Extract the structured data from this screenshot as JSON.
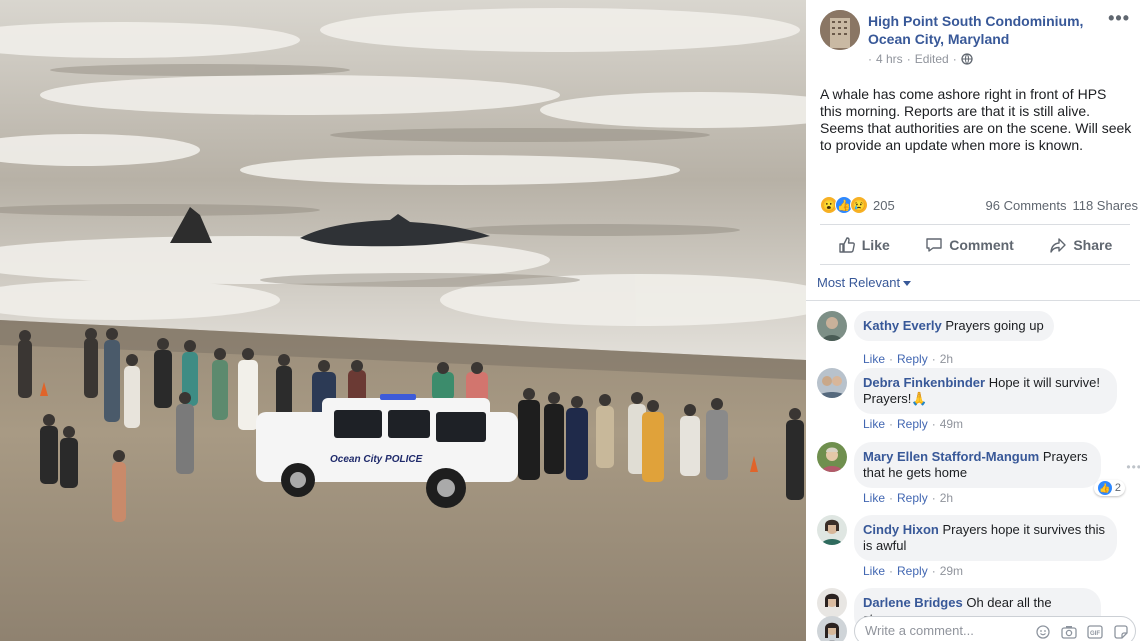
{
  "post": {
    "page_name_line1": "High Point South Condominium,",
    "page_name_line2": "Ocean City, Maryland",
    "time": "4 hrs",
    "edited": "Edited",
    "separator": "·",
    "text": "A whale has come ashore right in front of HPS this morning. Reports are that it is still alive. Seems that authorities are on the scene. Will seek to provide an update when more is known.",
    "reaction_count": "205",
    "comments_count": "96 Comments",
    "shares_count": "118 Shares"
  },
  "photo": {
    "vehicle_label": "Ocean City POLICE"
  },
  "actions": {
    "like": "Like",
    "comment": "Comment",
    "share": "Share"
  },
  "sort": {
    "label": "Most Relevant"
  },
  "comments": [
    {
      "name": "Kathy Everly",
      "text": "Prayers going up",
      "like": "Like",
      "reply": "Reply",
      "time": "2h"
    },
    {
      "name": "Debra Finkenbinder",
      "text": "Hope it will survive! Prayers!",
      "emoji": "🙏",
      "like": "Like",
      "reply": "Reply",
      "time": "49m"
    },
    {
      "name": "Mary Ellen Stafford-Mangum",
      "text": "Prayers that he gets home",
      "like": "Like",
      "reply": "Reply",
      "time": "2h",
      "reactions": "2"
    },
    {
      "name": "Cindy Hixon",
      "text": "Prayers hope it survives this is awful",
      "like": "Like",
      "reply": "Reply",
      "time": "29m"
    },
    {
      "name": "Darlene Bridges",
      "text": "Oh dear all the storms"
    }
  ],
  "composer": {
    "placeholder": "Write a comment..."
  },
  "icons": {
    "more": "more-options-icon",
    "globe": "globe-icon",
    "like": "thumbs-up-icon",
    "comment": "speech-bubble-icon",
    "share": "share-arrow-icon",
    "emoji": "emoji-icon",
    "camera": "camera-icon",
    "gif": "gif-icon",
    "sticker": "sticker-icon"
  },
  "colors": {
    "link_blue": "#385898",
    "text_gray": "#606770",
    "bubble_bg": "#f2f3f5",
    "like_blue": "#2d88ff"
  }
}
